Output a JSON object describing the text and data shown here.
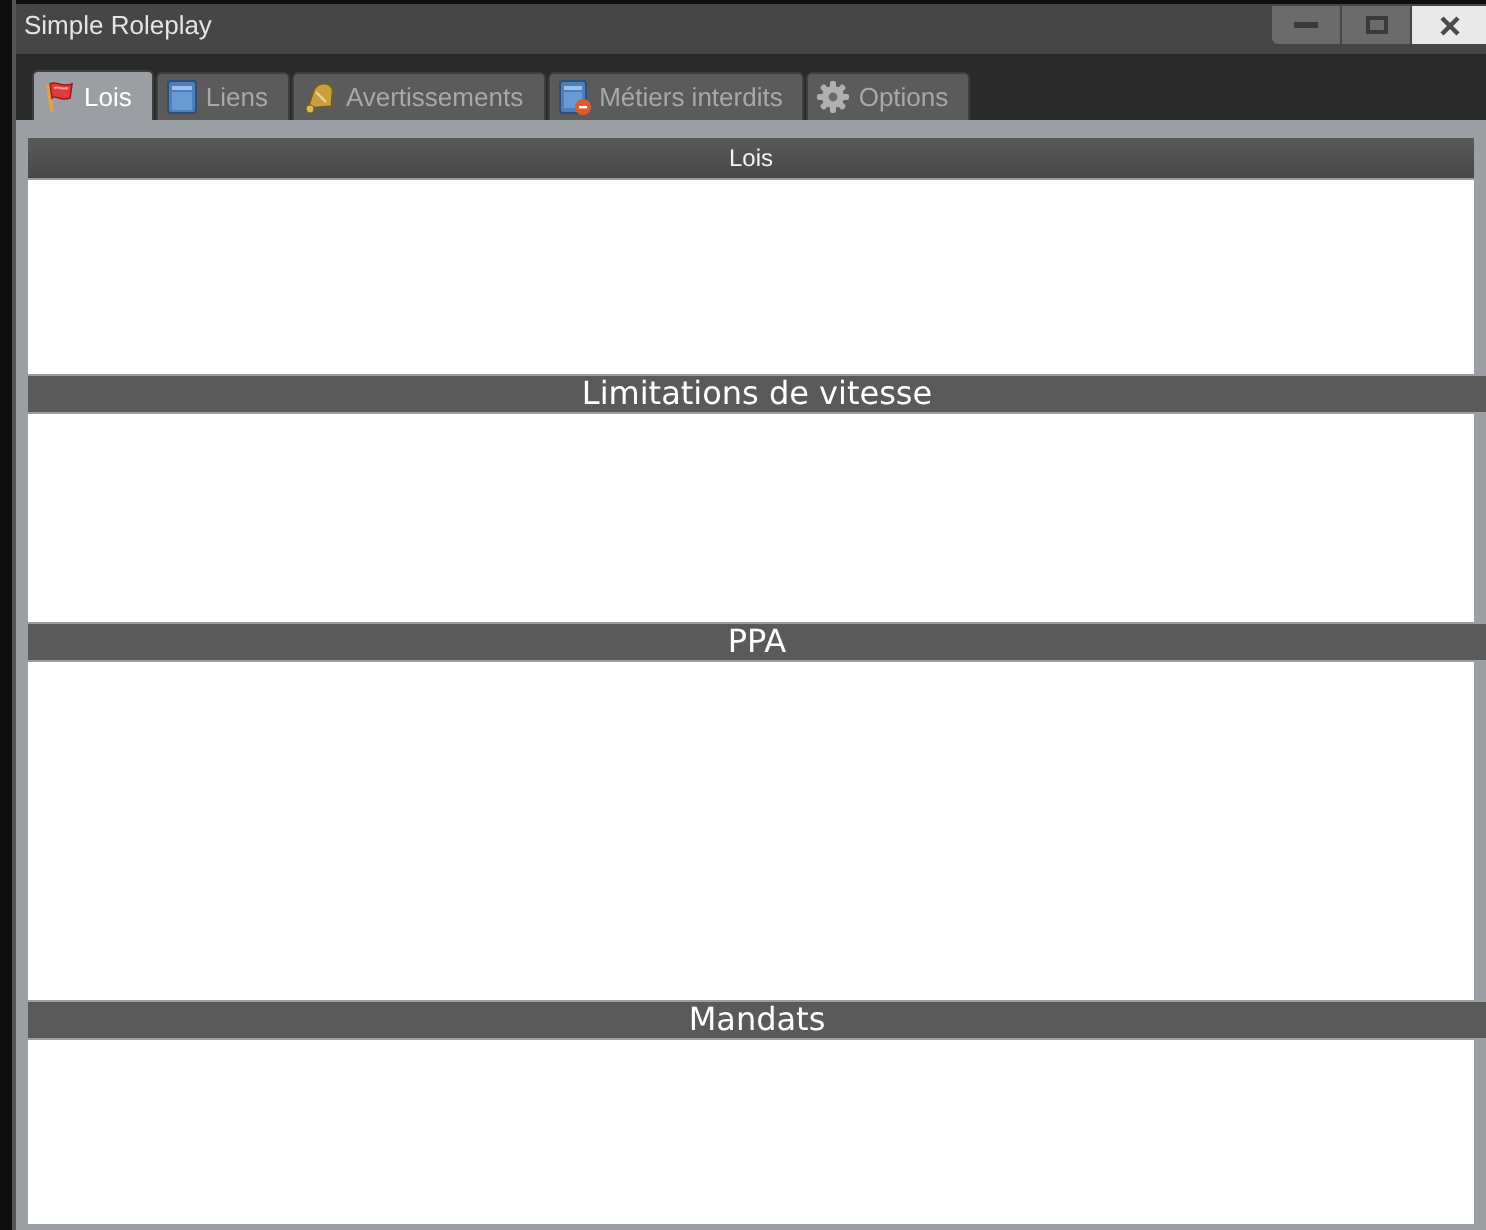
{
  "window": {
    "title": "Simple Roleplay"
  },
  "tabs": [
    {
      "label": "Lois",
      "selected": true
    },
    {
      "label": "Liens",
      "selected": false
    },
    {
      "label": "Avertissements",
      "selected": false
    },
    {
      "label": "Métiers interdits",
      "selected": false
    },
    {
      "label": "Options",
      "selected": false
    }
  ],
  "panel": {
    "title": "Lois",
    "sections": [
      {
        "title": "Limitations de vitesse"
      },
      {
        "title": "PPA"
      },
      {
        "title": "Mandats"
      }
    ]
  }
}
